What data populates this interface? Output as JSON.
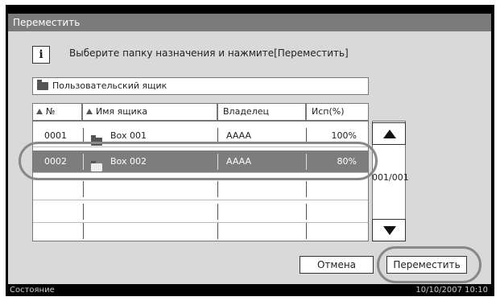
{
  "window": {
    "title": "Переместить"
  },
  "message": {
    "info_glyph": "i",
    "text": "Выберите папку назначения и нажмите[Переместить]"
  },
  "breadcrumb": {
    "label": "Пользовательский ящик"
  },
  "table": {
    "columns": {
      "number": "№",
      "name": "Имя ящика",
      "owner": "Владелец",
      "usage": "Исп(%)"
    },
    "rows": [
      {
        "number": "0001",
        "name": "Box 001",
        "owner": "AAAA",
        "usage": "100%"
      },
      {
        "number": "0002",
        "name": "Box 002",
        "owner": "AAAA",
        "usage": "80%",
        "selected": true
      }
    ]
  },
  "pager": {
    "indicator": "001/001"
  },
  "buttons": {
    "cancel": "Отмена",
    "move": "Переместить"
  },
  "status": {
    "label": "Состояние",
    "datetime": "10/10/2007   10:10"
  },
  "colors": {
    "selected_row": "#7d7d7d",
    "title_bar": "#7b7b7b",
    "panel": "#d9d9d9"
  }
}
